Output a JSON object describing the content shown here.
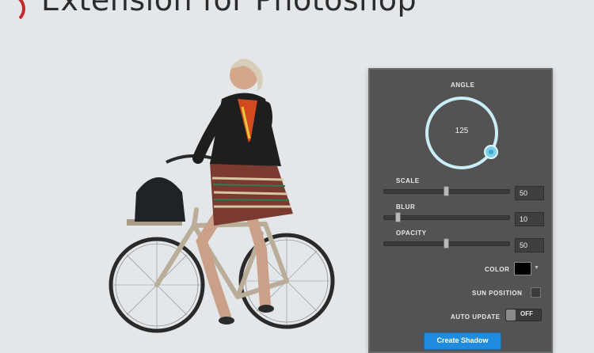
{
  "header": {
    "title": "Extension for Photoshop"
  },
  "panel": {
    "angle": {
      "label": "ANGLE",
      "value": "125"
    },
    "scale": {
      "label": "SCALE",
      "value": "50",
      "level": 0.5
    },
    "blur": {
      "label": "BLUR",
      "value": "10",
      "level": 0.1
    },
    "opacity": {
      "label": "OPACITY",
      "value": "50",
      "level": 0.5
    },
    "color": {
      "label": "COLOR",
      "swatch": "#000000"
    },
    "sun_position": {
      "label": "SUN POSITION",
      "checked": false
    },
    "auto_update": {
      "label": "AUTO UPDATE",
      "state": "OFF"
    },
    "create_button": "Create Shadow"
  },
  "colors": {
    "panel_bg": "#535353",
    "accent": "#1f8ce0",
    "dial_ring": "#c9eef7",
    "background": "#e4e7ea"
  },
  "icons": [
    "dropdown-caret-icon",
    "toggle-switch-icon"
  ]
}
